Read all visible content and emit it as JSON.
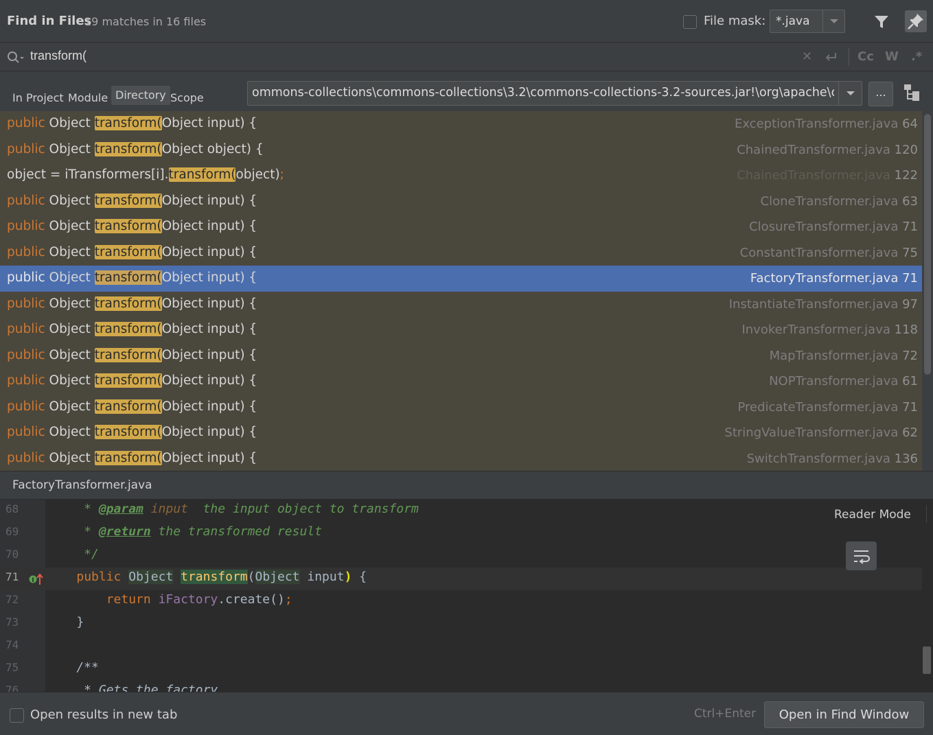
{
  "header": {
    "title": "Find in Files",
    "subtitle": "19 matches in 16 files",
    "file_mask_label": "File mask:",
    "file_mask_value": "*.java"
  },
  "search": {
    "query": "transform(",
    "case_label": "Cc",
    "words_label": "W",
    "regex_label": ".*"
  },
  "scope": {
    "tabs": [
      "In Project",
      "Module",
      "Directory",
      "Scope"
    ],
    "active_tab": "Directory",
    "directory": "ommons-collections\\commons-collections\\3.2\\commons-collections-3.2-sources.jar!\\org\\apache\\co",
    "browse_label": "..."
  },
  "results": [
    {
      "prefix_kw": "public",
      "prefix": " Object ",
      "match": "transform(",
      "suffix": "Object input) {",
      "file": "ExceptionTransformer.java",
      "line": "64"
    },
    {
      "prefix_kw": "public",
      "prefix": " Object ",
      "match": "transform(",
      "suffix": "Object object) {",
      "file": "ChainedTransformer.java",
      "line": "120"
    },
    {
      "prefix_kw": "",
      "prefix": "object = iTransformers[i].",
      "match": "transform(",
      "suffix": "object)",
      "semi": ";",
      "file": "ChainedTransformer.java",
      "line": "122"
    },
    {
      "prefix_kw": "public",
      "prefix": " Object ",
      "match": "transform(",
      "suffix": "Object input) {",
      "file": "CloneTransformer.java",
      "line": "63"
    },
    {
      "prefix_kw": "public",
      "prefix": " Object ",
      "match": "transform(",
      "suffix": "Object input) {",
      "file": "ClosureTransformer.java",
      "line": "71"
    },
    {
      "prefix_kw": "public",
      "prefix": " Object ",
      "match": "transform(",
      "suffix": "Object input) {",
      "file": "ConstantTransformer.java",
      "line": "75"
    },
    {
      "prefix_kw": "public",
      "prefix": " Object ",
      "match": "transform(",
      "suffix": "Object input) {",
      "file": "FactoryTransformer.java",
      "line": "71"
    },
    {
      "prefix_kw": "public",
      "prefix": " Object ",
      "match": "transform(",
      "suffix": "Object input) {",
      "file": "InstantiateTransformer.java",
      "line": "97"
    },
    {
      "prefix_kw": "public",
      "prefix": " Object ",
      "match": "transform(",
      "suffix": "Object input) {",
      "file": "InvokerTransformer.java",
      "line": "118"
    },
    {
      "prefix_kw": "public",
      "prefix": " Object ",
      "match": "transform(",
      "suffix": "Object input) {",
      "file": "MapTransformer.java",
      "line": "72"
    },
    {
      "prefix_kw": "public",
      "prefix": " Object ",
      "match": "transform(",
      "suffix": "Object input) {",
      "file": "NOPTransformer.java",
      "line": "61"
    },
    {
      "prefix_kw": "public",
      "prefix": " Object ",
      "match": "transform(",
      "suffix": "Object input) {",
      "file": "PredicateTransformer.java",
      "line": "71"
    },
    {
      "prefix_kw": "public",
      "prefix": " Object ",
      "match": "transform(",
      "suffix": "Object input) {",
      "file": "StringValueTransformer.java",
      "line": "62"
    },
    {
      "prefix_kw": "public",
      "prefix": " Object ",
      "match": "transform(",
      "suffix": "Object input) {",
      "file": "SwitchTransformer.java",
      "line": "136"
    }
  ],
  "selected_result": 6,
  "preview": {
    "filename": "FactoryTransformer.java",
    "reader_mode_label": "Reader Mode",
    "current_line": "71",
    "lines": [
      {
        "num": "68",
        "c1": "     * ",
        "tag": "@param",
        "param": " input",
        "c2": "  the input object to transform"
      },
      {
        "num": "69",
        "c1": "     * ",
        "tag": "@return",
        "param": "",
        "c2": " the transformed result"
      },
      {
        "num": "70",
        "c1": "     */",
        "tag": "",
        "param": "",
        "c2": ""
      },
      {
        "num": "71",
        "kw": "public",
        "sp1": " ",
        "type": "Object",
        "sp2": " ",
        "meth": "transform",
        "open": "(",
        "ptype": "Object",
        "rest": " input",
        "close": ")",
        "tail": " {"
      },
      {
        "num": "72",
        "indent": "        ",
        "kw": "return",
        "sp": " ",
        "field": "iFactory",
        "call": ".create()",
        "semi": ";"
      },
      {
        "num": "73",
        "code": "    }"
      },
      {
        "num": "74",
        "code": ""
      },
      {
        "num": "75",
        "comment": "    /**"
      },
      {
        "num": "76",
        "comment": "     * Gets the factory."
      }
    ]
  },
  "footer": {
    "new_tab_label": "Open results in new tab",
    "shortcut": "Ctrl+Enter",
    "open_button": "Open in Find Window"
  },
  "colors": {
    "keyword": "#cc7832",
    "match_highlight": "#d2a94a",
    "selection": "#4b6eaf",
    "results_bg": "#4a473d",
    "comment": "#629755"
  }
}
